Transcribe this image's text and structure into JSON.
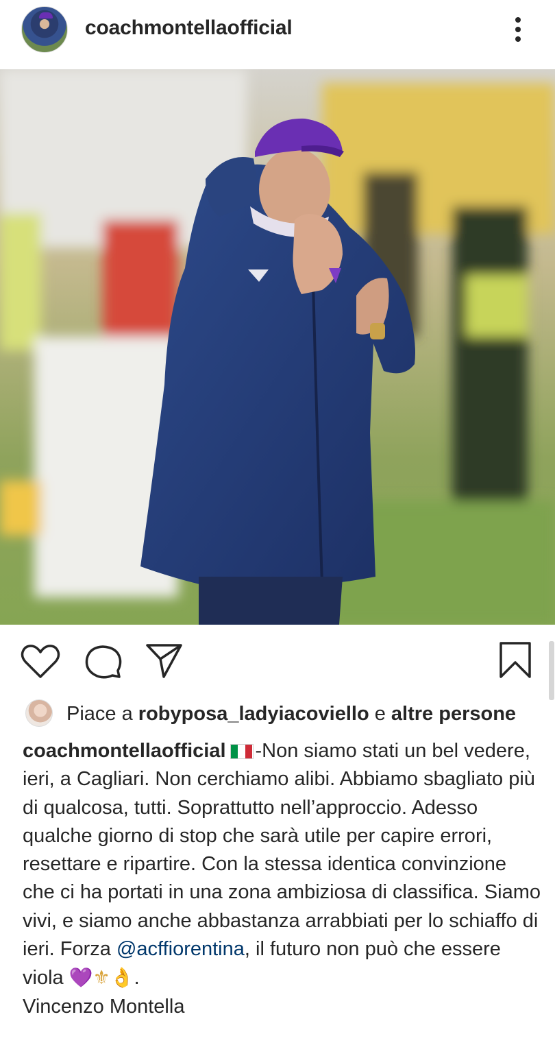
{
  "post": {
    "username": "coachmontellaofficial",
    "more_icon": "more-vertical-icon",
    "photo_alt": "Coach in purple cap and navy padded jacket gesturing on the sideline"
  },
  "actions": {
    "icons": [
      "heart-icon",
      "comment-icon",
      "share-icon",
      "bookmark-icon"
    ]
  },
  "likes": {
    "prefix": "Piace a",
    "user": "robyposa_ladyiacoviello",
    "joiner": "e",
    "others": "altre persone"
  },
  "caption": {
    "username": "coachmontellaofficial",
    "text_before_mention": "-Non siamo stati un bel vedere, ieri, a Cagliari. Non cerchiamo alibi. Abbiamo sbagliato più di qualcosa, tutti. Soprattutto nell’approccio. Adesso qualche giorno di stop che sarà utile per capire errori, resettare e ripartire. Con la stessa identica convinzione che ci ha portati in una zona ambiziosa di classifica. Siamo vivi, e siamo anche abbastanza arrabbiati per lo schiaffo di ieri. Forza ",
    "mention": "@acffiorentina",
    "text_after_mention": ", il futuro non può che essere viola ",
    "emoji_heart": "💜",
    "emoji_lily": "⚜",
    "emoji_hand": "👌",
    "end_punct": ".",
    "signature": "Vincenzo Montella"
  },
  "colors": {
    "text": "#262626",
    "mention": "#00376b",
    "flag_green": "#009246",
    "flag_white": "#ffffff",
    "flag_red": "#ce2b37",
    "cap_purple": "#6a2fb3",
    "jacket_navy": "#233d78"
  }
}
